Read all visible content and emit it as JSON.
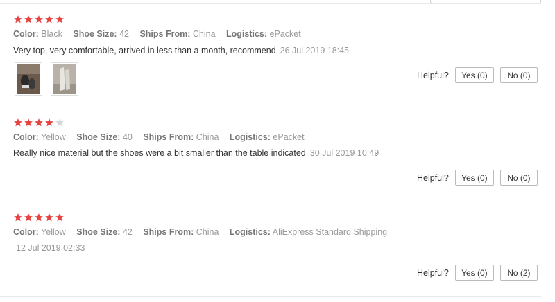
{
  "rating_color": "#e64340",
  "rating_empty_color": "#d6d6d6",
  "labels": {
    "color": "Color:",
    "shoe_size": "Shoe Size:",
    "ships_from": "Ships From:",
    "logistics": "Logistics:",
    "helpful": "Helpful?"
  },
  "reviews": [
    {
      "stars": 5,
      "color": "Black",
      "shoe_size": "42",
      "ships_from": "China",
      "logistics": "ePacket",
      "text": "Very top, very comfortable, arrived in less than a month, recommend",
      "date": "26 Jul 2019 18:45",
      "photos": [
        "photo-shoes-1",
        "photo-shoes-2"
      ],
      "yes": "Yes (0)",
      "no": "No (0)"
    },
    {
      "stars": 4,
      "color": "Yellow",
      "shoe_size": "40",
      "ships_from": "China",
      "logistics": "ePacket",
      "text": "Really nice material but the shoes were a bit smaller than the table indicated",
      "date": "30 Jul 2019 10:49",
      "photos": [],
      "yes": "Yes (0)",
      "no": "No (0)"
    },
    {
      "stars": 5,
      "color": "Yellow",
      "shoe_size": "42",
      "ships_from": "China",
      "logistics": "AliExpress Standard Shipping",
      "text": "",
      "date": "12 Jul 2019 02:33",
      "photos": [],
      "yes": "Yes (0)",
      "no": "No (2)"
    }
  ]
}
